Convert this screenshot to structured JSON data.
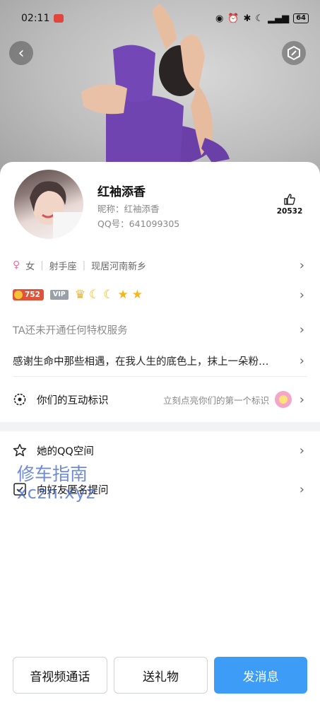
{
  "status_bar": {
    "time": "02:11",
    "battery": "64"
  },
  "profile": {
    "name": "红袖添香",
    "nickname": "昵称：红袖添香",
    "qq": "QQ号：641099305",
    "likes": "20532"
  },
  "info": {
    "gender": "女",
    "zodiac": "射手座",
    "location": "现居河南新乡"
  },
  "badges": {
    "level_coin": "752",
    "vip": "VIP"
  },
  "service_text": "TA还未开通任何特权服务",
  "bio": "感谢生命中那些相遇，在我人生的底色上，抹上一朵粉…",
  "interaction": {
    "label": "你们的互动标识",
    "hint": "立刻点亮你们的第一个标识"
  },
  "menu": {
    "qzone": "她的QQ空间",
    "ask": "向好友匿名提问"
  },
  "watermark": {
    "line1": "修车指南",
    "line2": "xczn.xyz"
  },
  "bottom_bar": {
    "call": "音视频通话",
    "gift": "送礼物",
    "message": "发消息"
  },
  "colors": {
    "accent": "#3d9cf5",
    "female": "#f06aa3",
    "coin": "#e0533b"
  }
}
